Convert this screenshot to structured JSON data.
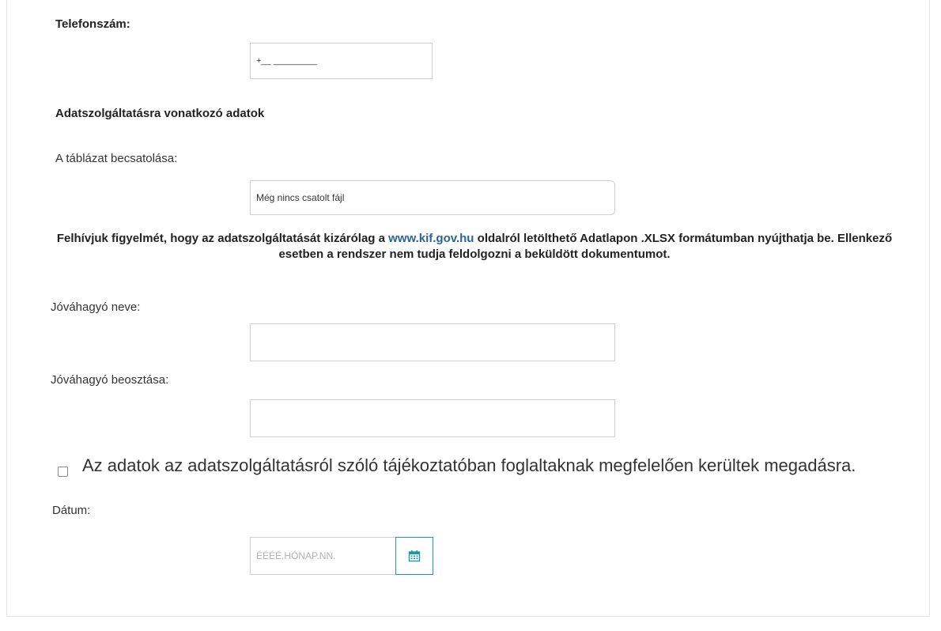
{
  "phone": {
    "label": "Telefonszám:",
    "value": "+__ _________"
  },
  "section_title": "Adatszolgáltatásra vonatkozó adatok",
  "attachment": {
    "label": "A táblázat becsatolása:",
    "value": "Még nincs csatolt fájl"
  },
  "notice": {
    "before_link": "Felhívjuk figyelmét, hogy az adatszolgáltatását kizárólag a ",
    "link": "www.kif.gov.hu",
    "after_link": " oldalról letölthető Adatlapon .XLSX formátumban nyújthatja be. Ellenkező esetben a rendszer nem tudja feldolgozni a beküldött dokumentumot."
  },
  "approver_name": {
    "label": "Jóváhagyó neve:",
    "value": ""
  },
  "approver_position": {
    "label": "Jóváhagyó beosztása:",
    "value": ""
  },
  "consent": {
    "label": "Az adatok az adatszolgáltatásról szóló tájékoztatóban foglaltaknak megfelelően kerültek megadásra.",
    "checked": false
  },
  "date": {
    "label": "Dátum:",
    "placeholder": "ÉÉÉÉ.HÓNAP.NN.",
    "icon": "calendar-icon",
    "accent": "#1a9aa0"
  }
}
